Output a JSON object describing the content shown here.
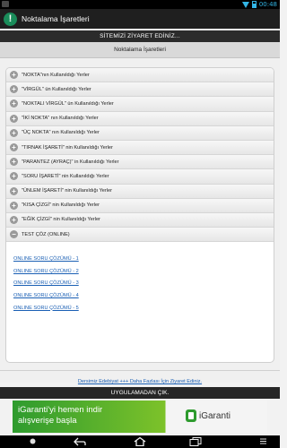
{
  "status": {
    "time": "00:48"
  },
  "app": {
    "title": "Noktalama İşaretleri"
  },
  "visit_banner": "SİTEMİZİ ZİYARET EDİNİZ...",
  "subheader": "Noktalama İşaretleri",
  "accordion": [
    {
      "icon": "plus-icon",
      "label": "\"NOKTA\"nın Kullanıldığı Yerler"
    },
    {
      "icon": "plus-icon",
      "label": "\"VİRGÜL\" ün Kullanıldığı Yerler"
    },
    {
      "icon": "plus-icon",
      "label": "\"NOKTALI VİRGÜL\" ün Kullanıldığı Yerler"
    },
    {
      "icon": "plus-icon",
      "label": "\"İKİ NOKTA\" nın Kullanıldığı Yerler"
    },
    {
      "icon": "plus-icon",
      "label": "\"ÜÇ NOKTA\" nın Kullanıldığı Yerler"
    },
    {
      "icon": "plus-icon",
      "label": "\"TIRNAK İŞARETİ\" nin Kullanıldığı Yerler"
    },
    {
      "icon": "plus-icon",
      "label": "\"PARANTEZ (AYRAÇ)\" in Kullanıldığı Yerler"
    },
    {
      "icon": "plus-icon",
      "label": "\"SORU İŞARETİ\" nin Kullanıldığı Yerler"
    },
    {
      "icon": "plus-icon",
      "label": "\"ÜNLEM İŞARETİ\" nin Kullanıldığı Yerler"
    },
    {
      "icon": "plus-icon",
      "label": "\"KISA ÇİZGİ\" nin Kullanıldığı Yerler"
    },
    {
      "icon": "plus-icon",
      "label": "\"EĞİK ÇİZGİ\" nin Kullanıldığı Yerler"
    },
    {
      "icon": "minus-icon",
      "label": "TEST ÇÖZ (ONLINE)"
    }
  ],
  "quiz_links": [
    "ONLINE SORU ÇÖZÜMÜ - 1",
    "ONLINE SORU ÇÖZÜMÜ - 2",
    "ONLINE SORU ÇÖZÜMÜ - 3",
    "ONLINE SORU ÇÖZÜMÜ - 4",
    "ONLINE SORU ÇÖZÜMÜ - 5"
  ],
  "footer_link": "Dersimiz Edebiyat +++ Daha Fazlası İçin Ziyaret Ediniz.",
  "exit_label": "UYGULAMADAN ÇIK.",
  "ad": {
    "line1": "iGaranti'yi hemen indir",
    "line2": "alışverişe başla",
    "brand": "iGaranti"
  },
  "colors": {
    "link": "#1a5fb4",
    "accent": "#33b5e5",
    "ad_green": "#2e9b2e"
  }
}
